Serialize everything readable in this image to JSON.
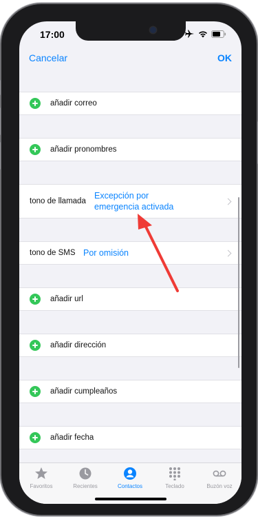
{
  "status_bar": {
    "time": "17:00",
    "icons": [
      "airplane-icon",
      "wifi-icon",
      "battery-icon"
    ]
  },
  "nav": {
    "cancel_label": "Cancelar",
    "ok_label": "OK"
  },
  "rows": {
    "add_email": "añadir correo",
    "add_pronouns": "añadir pronombres",
    "ringtone_label": "tono de llamada",
    "ringtone_value_line1": "Excepción por",
    "ringtone_value_line2": "emergencia activada",
    "sms_label": "tono de SMS",
    "sms_value": "Por omisión",
    "add_url": "añadir url",
    "add_address": "añadir dirección",
    "add_birthday": "añadir cumpleaños",
    "add_date": "añadir fecha"
  },
  "tabs": [
    {
      "label": "Favoritos",
      "icon": "star-icon",
      "active": false
    },
    {
      "label": "Recientes",
      "icon": "clock-icon",
      "active": false
    },
    {
      "label": "Contactos",
      "icon": "person-icon",
      "active": true
    },
    {
      "label": "Teclado",
      "icon": "keypad-icon",
      "active": false
    },
    {
      "label": "Buzón voz",
      "icon": "voicemail-icon",
      "active": false
    }
  ],
  "colors": {
    "accent": "#0a84ff",
    "add_green": "#34c759",
    "annotation_arrow": "#ef3b36"
  }
}
